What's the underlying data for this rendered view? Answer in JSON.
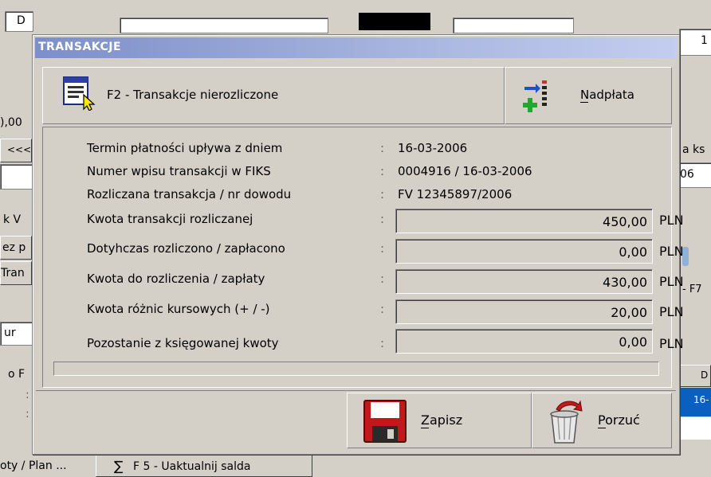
{
  "background": {
    "field_left_top": "D",
    "field_right_top": "1",
    "amount_left": "),00",
    "nav_left": "<<<",
    "label_right_1": "a ks",
    "label_right_2": "06",
    "label_left_1": "k V",
    "label_left_2": "ez p",
    "label_left_3": "Tran",
    "label_right_f7": "- F7",
    "label_left_4": "ur",
    "label_left_5": "o F",
    "col_header_right": "D",
    "cell_blue": "16-",
    "tab_left": "oty / Plan ...",
    "tab_f5": "F 5 -  Uaktualnij salda",
    "tab_f5_icon": "sigma-icon"
  },
  "dialog": {
    "title": "TRANSAKCJE",
    "f2_button_label": "F2 - Transakcje nierozliczone",
    "f2_icon": "document-cursor-icon",
    "overpay_button_label": "Nadpłata",
    "overpay_icon": "list-arrow-plus-icon",
    "rows_text": [
      {
        "label": "Termin płatności upływa z dniem",
        "colon": ":",
        "value": "16-03-2006"
      },
      {
        "label": "Numer wpisu transakcji w FIKS",
        "colon": ":",
        "value": "0004916 / 16-03-2006"
      },
      {
        "label": "Rozliczana transakcja / nr dowodu",
        "colon": ":",
        "value": "FV 12345897/2006"
      }
    ],
    "rows_amount": [
      {
        "label": "Kwota transakcji rozliczanej",
        "colon": ":",
        "value": "450,00",
        "currency": "PLN"
      },
      {
        "label": "Dotyhczas rozliczono / zapłacono",
        "colon": ":",
        "value": "0,00",
        "currency": "PLN"
      },
      {
        "label": "Kwota do rozliczenia / zapłaty",
        "colon": ":",
        "value": "430,00",
        "currency": "PLN"
      },
      {
        "label": "Kwota różnic kursowych (+ / -)",
        "colon": ":",
        "value": "20,00",
        "currency": "PLN"
      },
      {
        "label": "Pozostanie z księgowanej kwoty",
        "colon": ":",
        "value": "0,00",
        "currency": "PLN"
      }
    ],
    "save_label": "Zapisz",
    "save_icon": "floppy-disk-icon",
    "discard_label": "Porzuć",
    "discard_icon": "trash-bin-icon"
  },
  "colors": {
    "title_gradient_start": "#7d8fc9",
    "title_gradient_end": "#c3cdef",
    "selected_row": "#0a5fbf"
  }
}
